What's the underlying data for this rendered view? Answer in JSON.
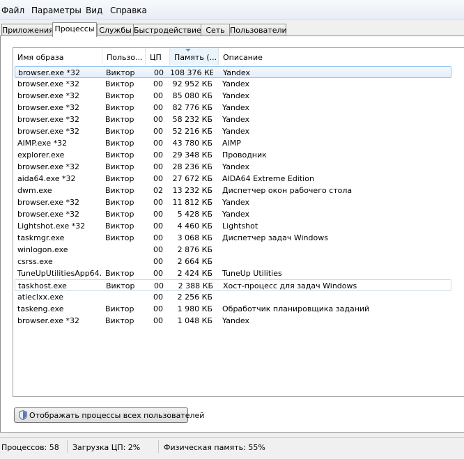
{
  "menu": [
    {
      "label": "Файл"
    },
    {
      "label": "Параметры"
    },
    {
      "label": "Вид"
    },
    {
      "label": "Справка"
    }
  ],
  "tabs": [
    {
      "label": "Приложения"
    },
    {
      "label": "Процессы"
    },
    {
      "label": "Службы"
    },
    {
      "label": "Быстродействие"
    },
    {
      "label": "Сеть"
    },
    {
      "label": "Пользователи"
    }
  ],
  "active_tab": "Процессы",
  "columns": {
    "name": "Имя образа",
    "user": "Пользо...",
    "cpu": "ЦП",
    "memory": "Память (...",
    "description": "Описание"
  },
  "sorted_column": "memory",
  "processes": [
    {
      "name": "browser.exe *32",
      "user": "Виктор",
      "cpu": "00",
      "memory": "108 376 КБ",
      "description": "Yandex"
    },
    {
      "name": "browser.exe *32",
      "user": "Виктор",
      "cpu": "00",
      "memory": "92 952 КБ",
      "description": "Yandex"
    },
    {
      "name": "browser.exe *32",
      "user": "Виктор",
      "cpu": "00",
      "memory": "85 080 КБ",
      "description": "Yandex"
    },
    {
      "name": "browser.exe *32",
      "user": "Виктор",
      "cpu": "00",
      "memory": "82 776 КБ",
      "description": "Yandex"
    },
    {
      "name": "browser.exe *32",
      "user": "Виктор",
      "cpu": "00",
      "memory": "58 232 КБ",
      "description": "Yandex"
    },
    {
      "name": "browser.exe *32",
      "user": "Виктор",
      "cpu": "00",
      "memory": "52 216 КБ",
      "description": "Yandex"
    },
    {
      "name": "AIMP.exe *32",
      "user": "Виктор",
      "cpu": "00",
      "memory": "43 780 КБ",
      "description": "AIMP"
    },
    {
      "name": "explorer.exe",
      "user": "Виктор",
      "cpu": "00",
      "memory": "29 348 КБ",
      "description": "Проводник"
    },
    {
      "name": "browser.exe *32",
      "user": "Виктор",
      "cpu": "00",
      "memory": "28 236 КБ",
      "description": "Yandex"
    },
    {
      "name": "aida64.exe *32",
      "user": "Виктор",
      "cpu": "00",
      "memory": "27 672 КБ",
      "description": "AIDA64 Extreme Edition"
    },
    {
      "name": "dwm.exe",
      "user": "Виктор",
      "cpu": "02",
      "memory": "13 232 КБ",
      "description": "Диспетчер окон рабочего стола"
    },
    {
      "name": "browser.exe *32",
      "user": "Виктор",
      "cpu": "00",
      "memory": "11 812 КБ",
      "description": "Yandex"
    },
    {
      "name": "browser.exe *32",
      "user": "Виктор",
      "cpu": "00",
      "memory": "5 428 КБ",
      "description": "Yandex"
    },
    {
      "name": "Lightshot.exe *32",
      "user": "Виктор",
      "cpu": "00",
      "memory": "4 460 КБ",
      "description": "Lightshot"
    },
    {
      "name": "taskmgr.exe",
      "user": "Виктор",
      "cpu": "00",
      "memory": "3 068 КБ",
      "description": "Диспетчер задач Windows"
    },
    {
      "name": "winlogon.exe",
      "user": "",
      "cpu": "00",
      "memory": "2 876 КБ",
      "description": ""
    },
    {
      "name": "csrss.exe",
      "user": "",
      "cpu": "00",
      "memory": "2 664 КБ",
      "description": ""
    },
    {
      "name": "TuneUpUtilitiesApp64....",
      "user": "Виктор",
      "cpu": "00",
      "memory": "2 424 КБ",
      "description": "TuneUp Utilities"
    },
    {
      "name": "taskhost.exe",
      "user": "Виктор",
      "cpu": "00",
      "memory": "2 388 КБ",
      "description": "Хост-процесс для задач Windows"
    },
    {
      "name": "atieclxx.exe",
      "user": "",
      "cpu": "00",
      "memory": "2 256 КБ",
      "description": ""
    },
    {
      "name": "taskeng.exe",
      "user": "Виктор",
      "cpu": "00",
      "memory": "1 980 КБ",
      "description": "Обработчик планировщика заданий"
    },
    {
      "name": "browser.exe *32",
      "user": "Виктор",
      "cpu": "00",
      "memory": "1 048 КБ",
      "description": "Yandex"
    }
  ],
  "selected_row": 0,
  "hover_row": 18,
  "show_all_button": {
    "label": "Отображать процессы всех пользователей",
    "icon": "shield-icon"
  },
  "status": {
    "processes": "Процессов: 58",
    "cpu": "Загрузка ЦП: 2%",
    "memory": "Физическая память: 55%"
  }
}
